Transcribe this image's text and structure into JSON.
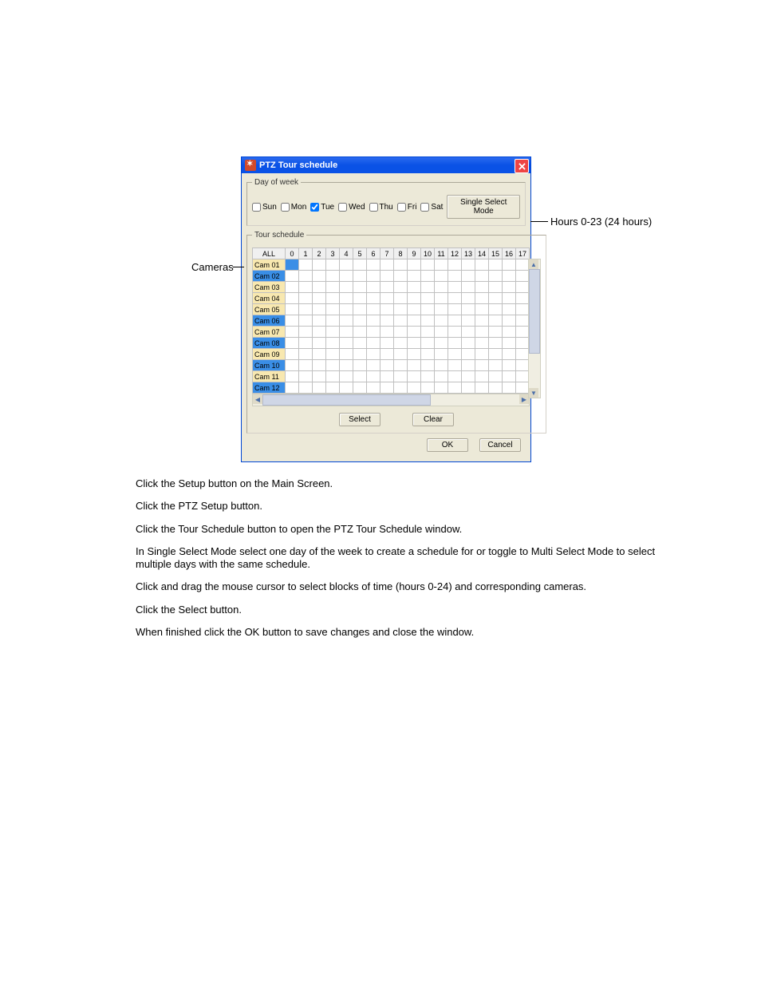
{
  "annotations": {
    "cameras_label": "Cameras",
    "hours_label": "Hours 0-23 (24 hours)"
  },
  "dialog": {
    "title": "PTZ Tour schedule",
    "day_of_week": {
      "legend": "Day of week",
      "days": [
        {
          "label": "Sun",
          "checked": false
        },
        {
          "label": "Mon",
          "checked": false
        },
        {
          "label": "Tue",
          "checked": true
        },
        {
          "label": "Wed",
          "checked": false
        },
        {
          "label": "Thu",
          "checked": false
        },
        {
          "label": "Fri",
          "checked": false
        },
        {
          "label": "Sat",
          "checked": false
        }
      ],
      "mode_button": "Single Select Mode"
    },
    "tour_schedule": {
      "legend": "Tour schedule",
      "corner": "ALL",
      "hours": [
        "0",
        "1",
        "2",
        "3",
        "4",
        "5",
        "6",
        "7",
        "8",
        "9",
        "10",
        "11",
        "12",
        "13",
        "14",
        "15",
        "16",
        "17"
      ],
      "cameras": [
        {
          "label": "Cam 01",
          "selected": false
        },
        {
          "label": "Cam 02",
          "selected": true
        },
        {
          "label": "Cam 03",
          "selected": false
        },
        {
          "label": "Cam 04",
          "selected": false
        },
        {
          "label": "Cam 05",
          "selected": false
        },
        {
          "label": "Cam 06",
          "selected": true
        },
        {
          "label": "Cam 07",
          "selected": false
        },
        {
          "label": "Cam 08",
          "selected": true
        },
        {
          "label": "Cam 09",
          "selected": false
        },
        {
          "label": "Cam 10",
          "selected": true
        },
        {
          "label": "Cam 11",
          "selected": false
        },
        {
          "label": "Cam 12",
          "selected": true
        }
      ],
      "selected_cell": {
        "row": 0,
        "col": 0
      },
      "select_button": "Select",
      "clear_button": "Clear"
    },
    "ok_button": "OK",
    "cancel_button": "Cancel"
  },
  "instructions": [
    "Click the Setup button on the Main Screen.",
    "Click the PTZ Setup button.",
    "Click the Tour Schedule button to open the PTZ Tour Schedule window.",
    "In Single Select Mode select one day of the week to create a schedule for or toggle to Multi Select Mode to select multiple days with the same schedule.",
    "Click and drag the mouse cursor to select blocks of time (hours 0-24) and corresponding cameras.",
    "Click the Select button.",
    "When finished click the OK button to save changes and close the window."
  ]
}
